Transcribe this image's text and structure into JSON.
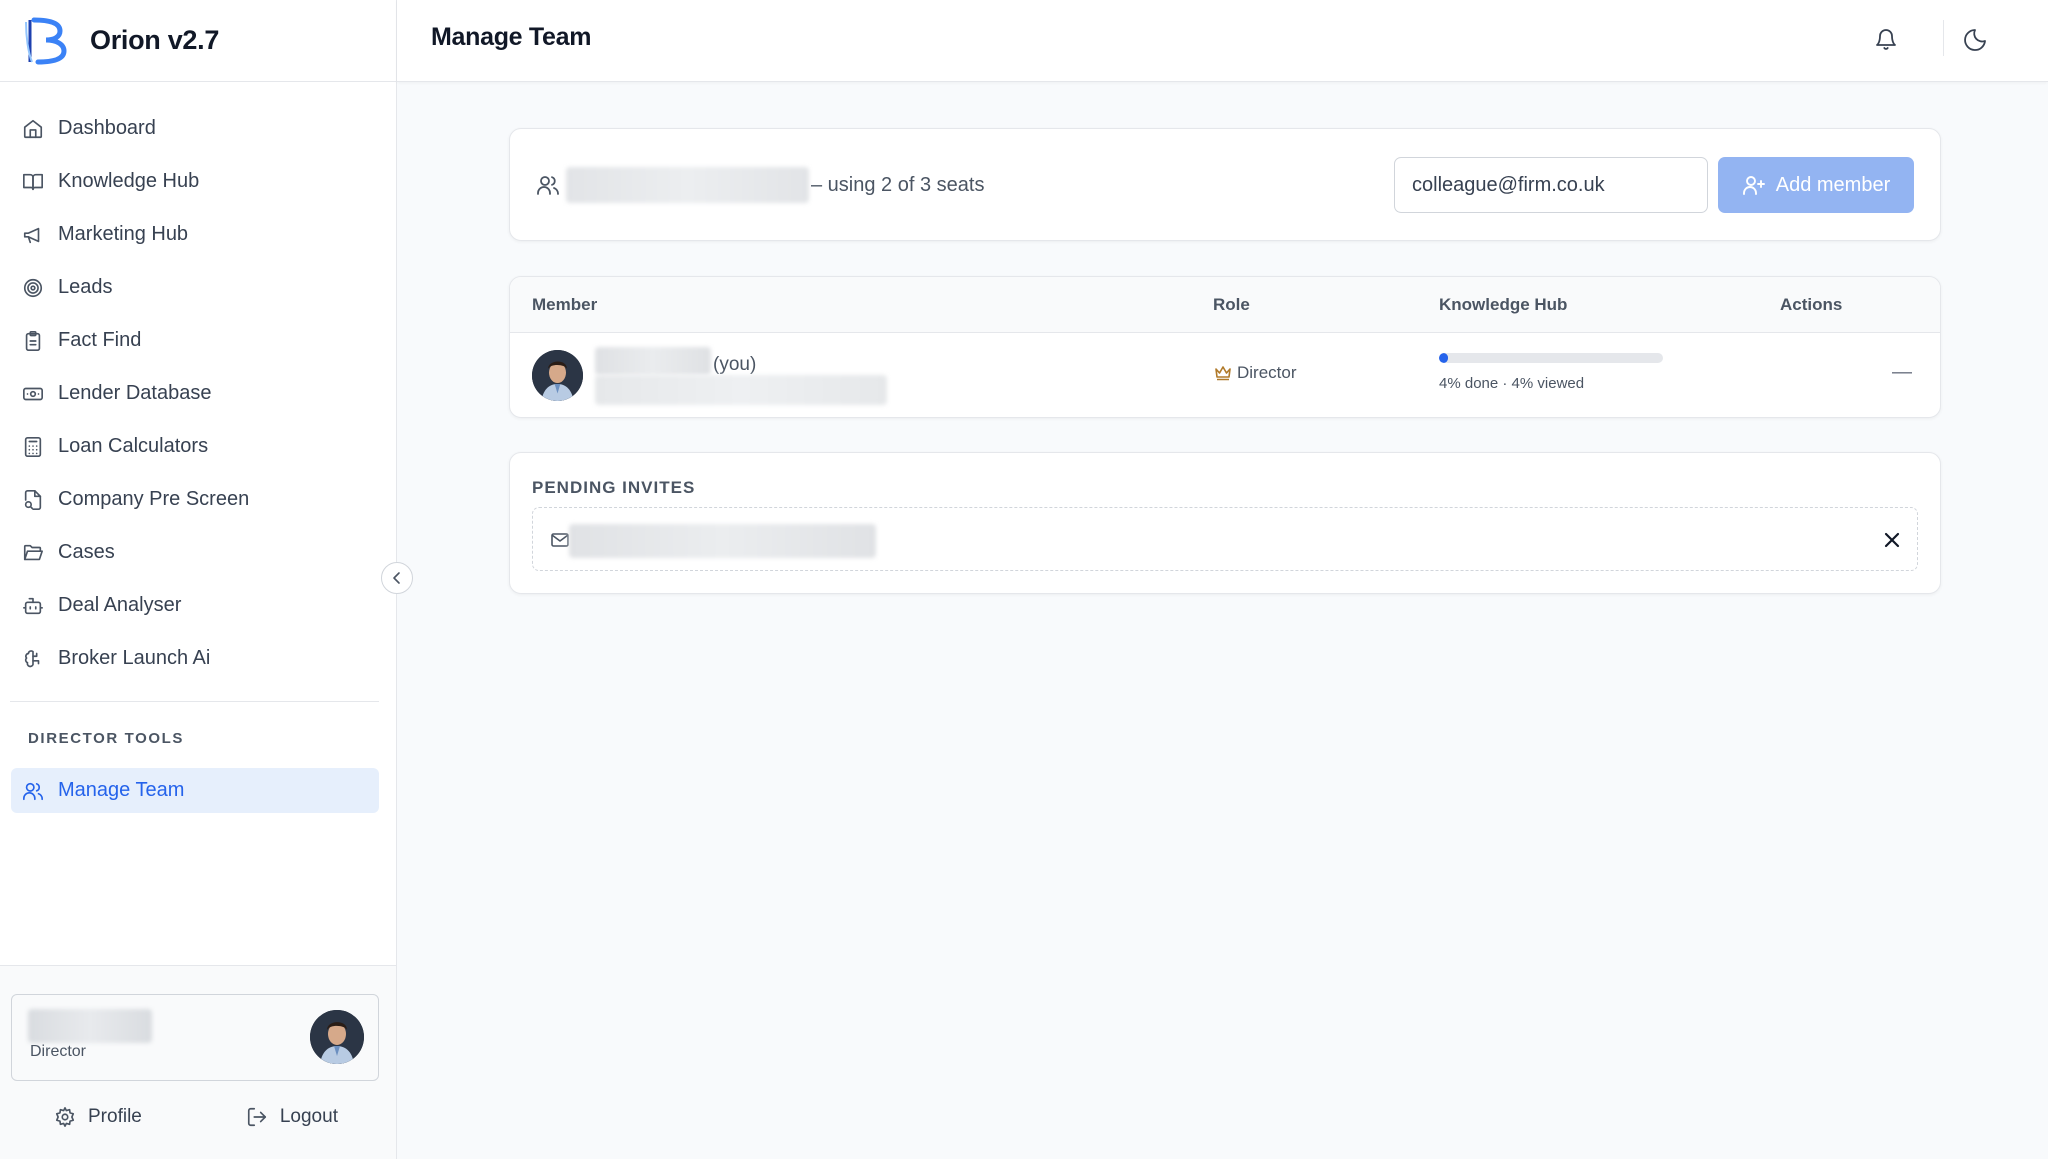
{
  "brand": {
    "name": "Orion v2.7"
  },
  "header": {
    "title": "Manage Team"
  },
  "sidebar": {
    "items": [
      {
        "label": "Dashboard"
      },
      {
        "label": "Knowledge Hub"
      },
      {
        "label": "Marketing Hub"
      },
      {
        "label": "Leads"
      },
      {
        "label": "Fact Find"
      },
      {
        "label": "Lender Database"
      },
      {
        "label": "Loan Calculators"
      },
      {
        "label": "Company Pre Screen"
      },
      {
        "label": "Cases"
      },
      {
        "label": "Deal Analyser"
      },
      {
        "label": "Broker Launch Ai"
      }
    ],
    "section_label": "DIRECTOR TOOLS",
    "active_item": {
      "label": "Manage Team"
    }
  },
  "user": {
    "role": "Director",
    "profile_label": "Profile",
    "logout_label": "Logout"
  },
  "seats": {
    "summary": "– using 2 of 3 seats",
    "email_placeholder": "colleague@firm.co.uk",
    "add_label": "Add member"
  },
  "table": {
    "columns": [
      "Member",
      "Role",
      "Knowledge Hub",
      "Actions"
    ],
    "rows": [
      {
        "you_label": "(you)",
        "role": "Director",
        "progress_fraction": 0.04,
        "progress_text": "4% done · 4% viewed",
        "action": "—"
      }
    ]
  },
  "pending": {
    "label": "PENDING INVITES"
  },
  "colors": {
    "accent": "#2563eb",
    "active_bg": "#e6effc",
    "button_bg": "#93b4f2",
    "crown": "#b07a2a"
  }
}
